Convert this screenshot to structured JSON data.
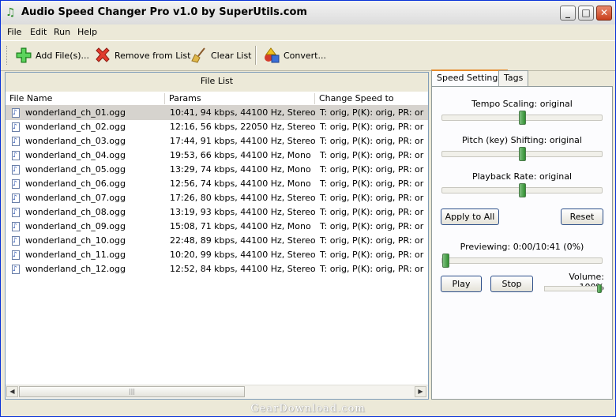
{
  "window": {
    "title": "Audio Speed Changer Pro v1.0 by SuperUtils.com",
    "controls": {
      "minimize": "_",
      "maximize": "□",
      "close": "✕"
    }
  },
  "menu": [
    "File",
    "Edit",
    "Run",
    "Help"
  ],
  "toolbar": {
    "add_files": "Add File(s)...",
    "remove": "Remove from List",
    "clear": "Clear List",
    "convert": "Convert..."
  },
  "file_list": {
    "title": "File List",
    "columns": [
      "File Name",
      "Params",
      "Change Speed to"
    ],
    "rows": [
      {
        "name": "wonderland_ch_01.ogg",
        "params": "10:41, 94 kbps, 44100 Hz, Stereo",
        "speed": "T: orig, P(K): orig, PR: orig"
      },
      {
        "name": "wonderland_ch_02.ogg",
        "params": "12:16, 56 kbps, 22050 Hz, Stereo",
        "speed": "T: orig, P(K): orig, PR: orig"
      },
      {
        "name": "wonderland_ch_03.ogg",
        "params": "17:44, 91 kbps, 44100 Hz, Stereo",
        "speed": "T: orig, P(K): orig, PR: orig"
      },
      {
        "name": "wonderland_ch_04.ogg",
        "params": "19:53, 66 kbps, 44100 Hz, Mono",
        "speed": "T: orig, P(K): orig, PR: orig"
      },
      {
        "name": "wonderland_ch_05.ogg",
        "params": "13:29, 74 kbps, 44100 Hz, Mono",
        "speed": "T: orig, P(K): orig, PR: orig"
      },
      {
        "name": "wonderland_ch_06.ogg",
        "params": "12:56, 74 kbps, 44100 Hz, Mono",
        "speed": "T: orig, P(K): orig, PR: orig"
      },
      {
        "name": "wonderland_ch_07.ogg",
        "params": "17:26, 80 kbps, 44100 Hz, Stereo",
        "speed": "T: orig, P(K): orig, PR: orig"
      },
      {
        "name": "wonderland_ch_08.ogg",
        "params": "13:19, 93 kbps, 44100 Hz, Stereo",
        "speed": "T: orig, P(K): orig, PR: orig"
      },
      {
        "name": "wonderland_ch_09.ogg",
        "params": "15:08, 71 kbps, 44100 Hz, Mono",
        "speed": "T: orig, P(K): orig, PR: orig"
      },
      {
        "name": "wonderland_ch_10.ogg",
        "params": "22:48, 89 kbps, 44100 Hz, Stereo",
        "speed": "T: orig, P(K): orig, PR: orig"
      },
      {
        "name": "wonderland_ch_11.ogg",
        "params": "10:20, 99 kbps, 44100 Hz, Stereo",
        "speed": "T: orig, P(K): orig, PR: orig"
      },
      {
        "name": "wonderland_ch_12.ogg",
        "params": "12:52, 84 kbps, 44100 Hz, Stereo",
        "speed": "T: orig, P(K): orig, PR: orig"
      }
    ]
  },
  "tabs": [
    "Speed Settings",
    "Tags"
  ],
  "speed": {
    "tempo_label": "Tempo Scaling: original",
    "pitch_label": "Pitch (key) Shifting: original",
    "rate_label": "Playback Rate: original",
    "tempo_level": 0.5,
    "pitch_level": 0.5,
    "rate_level": 0.5,
    "apply_all": "Apply to All",
    "reset": "Reset",
    "preview_label": "Previewing: 0:00/10:41 (0%)",
    "preview_level": 0,
    "play": "Play",
    "stop": "Stop",
    "volume_label": "Volume: 100%",
    "volume_level": 1.0
  },
  "watermark": "GearDownload.com"
}
